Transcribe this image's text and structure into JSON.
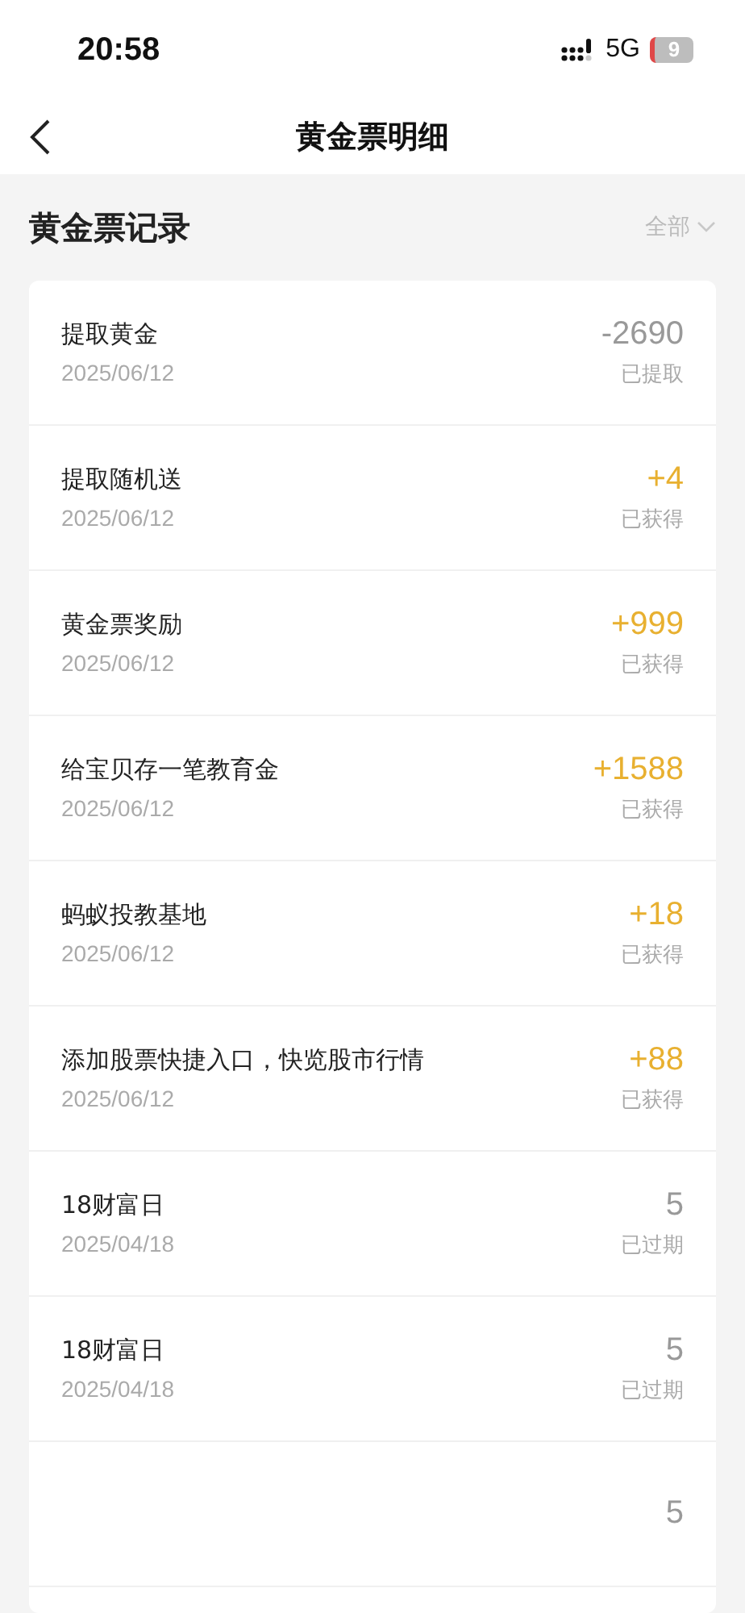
{
  "status_bar": {
    "time": "20:58",
    "network": "5G",
    "battery": "9"
  },
  "nav": {
    "title": "黄金票明细"
  },
  "section": {
    "title": "黄金票记录",
    "filter": "全部"
  },
  "records": [
    {
      "title": "提取黄金",
      "date": "2025/06/12",
      "amount": "-2690",
      "status": "已提取",
      "kind": "withdrawn"
    },
    {
      "title": "提取随机送",
      "date": "2025/06/12",
      "amount": "+4",
      "status": "已获得",
      "kind": "earned"
    },
    {
      "title": "黄金票奖励",
      "date": "2025/06/12",
      "amount": "+999",
      "status": "已获得",
      "kind": "earned"
    },
    {
      "title": "给宝贝存一笔教育金",
      "date": "2025/06/12",
      "amount": "+1588",
      "status": "已获得",
      "kind": "earned"
    },
    {
      "title": "蚂蚁投教基地",
      "date": "2025/06/12",
      "amount": "+18",
      "status": "已获得",
      "kind": "earned"
    },
    {
      "title": "添加股票快捷入口，快览股市行情",
      "date": "2025/06/12",
      "amount": "+88",
      "status": "已获得",
      "kind": "earned"
    },
    {
      "title": "18财富日",
      "date": "2025/04/18",
      "amount": "5",
      "status": "已过期",
      "kind": "expired"
    },
    {
      "title": "18财富日",
      "date": "2025/04/18",
      "amount": "5",
      "status": "已过期",
      "kind": "expired"
    },
    {
      "amount": "5",
      "kind": "expired"
    }
  ]
}
